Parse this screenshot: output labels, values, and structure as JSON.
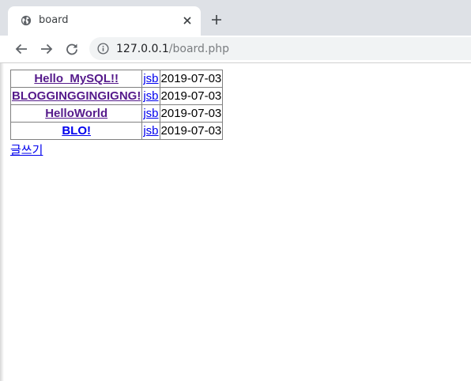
{
  "browser": {
    "tab": {
      "title": "board",
      "icon": "globe-icon"
    },
    "address": {
      "host": "127.0.0.1",
      "path": "/board.php"
    }
  },
  "board": {
    "rows": [
      {
        "title": "Hello  MySQL!!",
        "author": "jsb",
        "date": "2019-07-03",
        "visited": true
      },
      {
        "title": "BLOGGINGGINGIGNG!",
        "author": "jsb",
        "date": "2019-07-03",
        "visited": true
      },
      {
        "title": "HelloWorld",
        "author": "jsb",
        "date": "2019-07-03",
        "visited": true
      },
      {
        "title": "BLO!",
        "author": "jsb",
        "date": "2019-07-03",
        "visited": false
      }
    ],
    "write_label": "글쓰기"
  },
  "colors": {
    "visited_link": "#551a8b",
    "unvisited_link": "#0000ee",
    "tabstrip": "#dee1e6",
    "omnibox": "#f1f3f4"
  }
}
